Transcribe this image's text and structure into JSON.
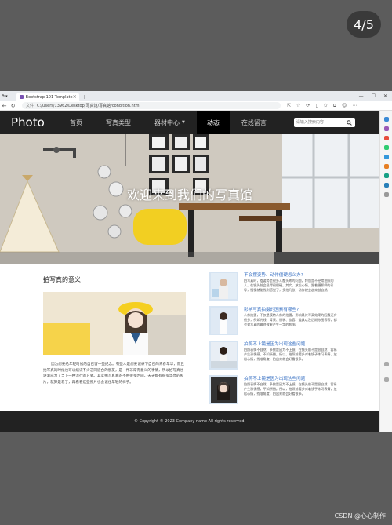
{
  "viewer": {
    "page_counter": "4/5",
    "watermark": "CSDN @心心制作"
  },
  "browser": {
    "tab_title": "Bootstrap 101 Template",
    "url_label": "文件",
    "url": "C:/Users/13962/Desktop/写真馆/写真馆/condition.html"
  },
  "site": {
    "brand": "Photo",
    "nav": [
      {
        "label": "首页"
      },
      {
        "label": "写真类型"
      },
      {
        "label": "器材中心"
      },
      {
        "label": "动态"
      },
      {
        "label": "在线留言"
      }
    ],
    "search_placeholder": "请输入搜索内容",
    "hero_title": "欢迎来到我们的写真馆",
    "section_title": "拍写真的意义",
    "article": "因为想要给年轻时候的自己留一些纪念。有些人是想要记录下自己的青春年华，而且拍写真的时候也可以结识不少志同道合的朋友，是一件非常有意义的事情，所以拍写真也逐渐成为了当下一种流行的方式。其实拍写真真的不用很多时间，天天都有很多漂亮的照片，就算是老了，再看看这些照片也会记住年轻的样子。",
    "news": [
      {
        "title": "不会摆姿势、动作僵硬怎么办?",
        "body": "拍写真时，摆姿势是很多人都头疼的问题，特别是不经常拍照的人，在镜头前会显得很僵硬。其实，放松心情，跟着摄影师的引导，慢慢就能找到感觉了，多拍几张，动作就会越来越自然。"
      },
      {
        "title": "影响写真拍摄的因素有哪些?",
        "body": "人像拍摄，不仅是模特人像的拍摄，影响最终写真效果的因素还有很多，例如光线、背景、服装、妆容、道具以及后期修图等等，都会对写真的最终效果产生一定的影响。"
      },
      {
        "title": "拍照不上镜是因为出现这些问题",
        "body": "拍照表情不自然，多数是因为不上镜，在镜头前不是很自然，容易产生恐惧感，不知所措。所以，拍照前要多对着镜子练习表情，放松心情，找准角度，拍出来就会好看很多。"
      },
      {
        "title": "拍照不上镜是因为出现这些问题",
        "body": "拍照表情不自然，多数是因为不上镜，在镜头前不是很自然，容易产生恐惧感，不知所措。所以，拍照前要多对着镜子练习表情，放松心情，找准角度，拍出来就会好看很多。"
      }
    ],
    "footer": "© Copyright © 2023 Company name All rights reserved."
  },
  "icons": {
    "search": "search-icon",
    "back": "back-arrow-icon",
    "forward": "forward-arrow-icon",
    "reload": "reload-icon",
    "close": "close-icon"
  },
  "colors": {
    "navbar": "#222222",
    "news_title": "#3b73c4",
    "background": "#5c5c5c"
  }
}
